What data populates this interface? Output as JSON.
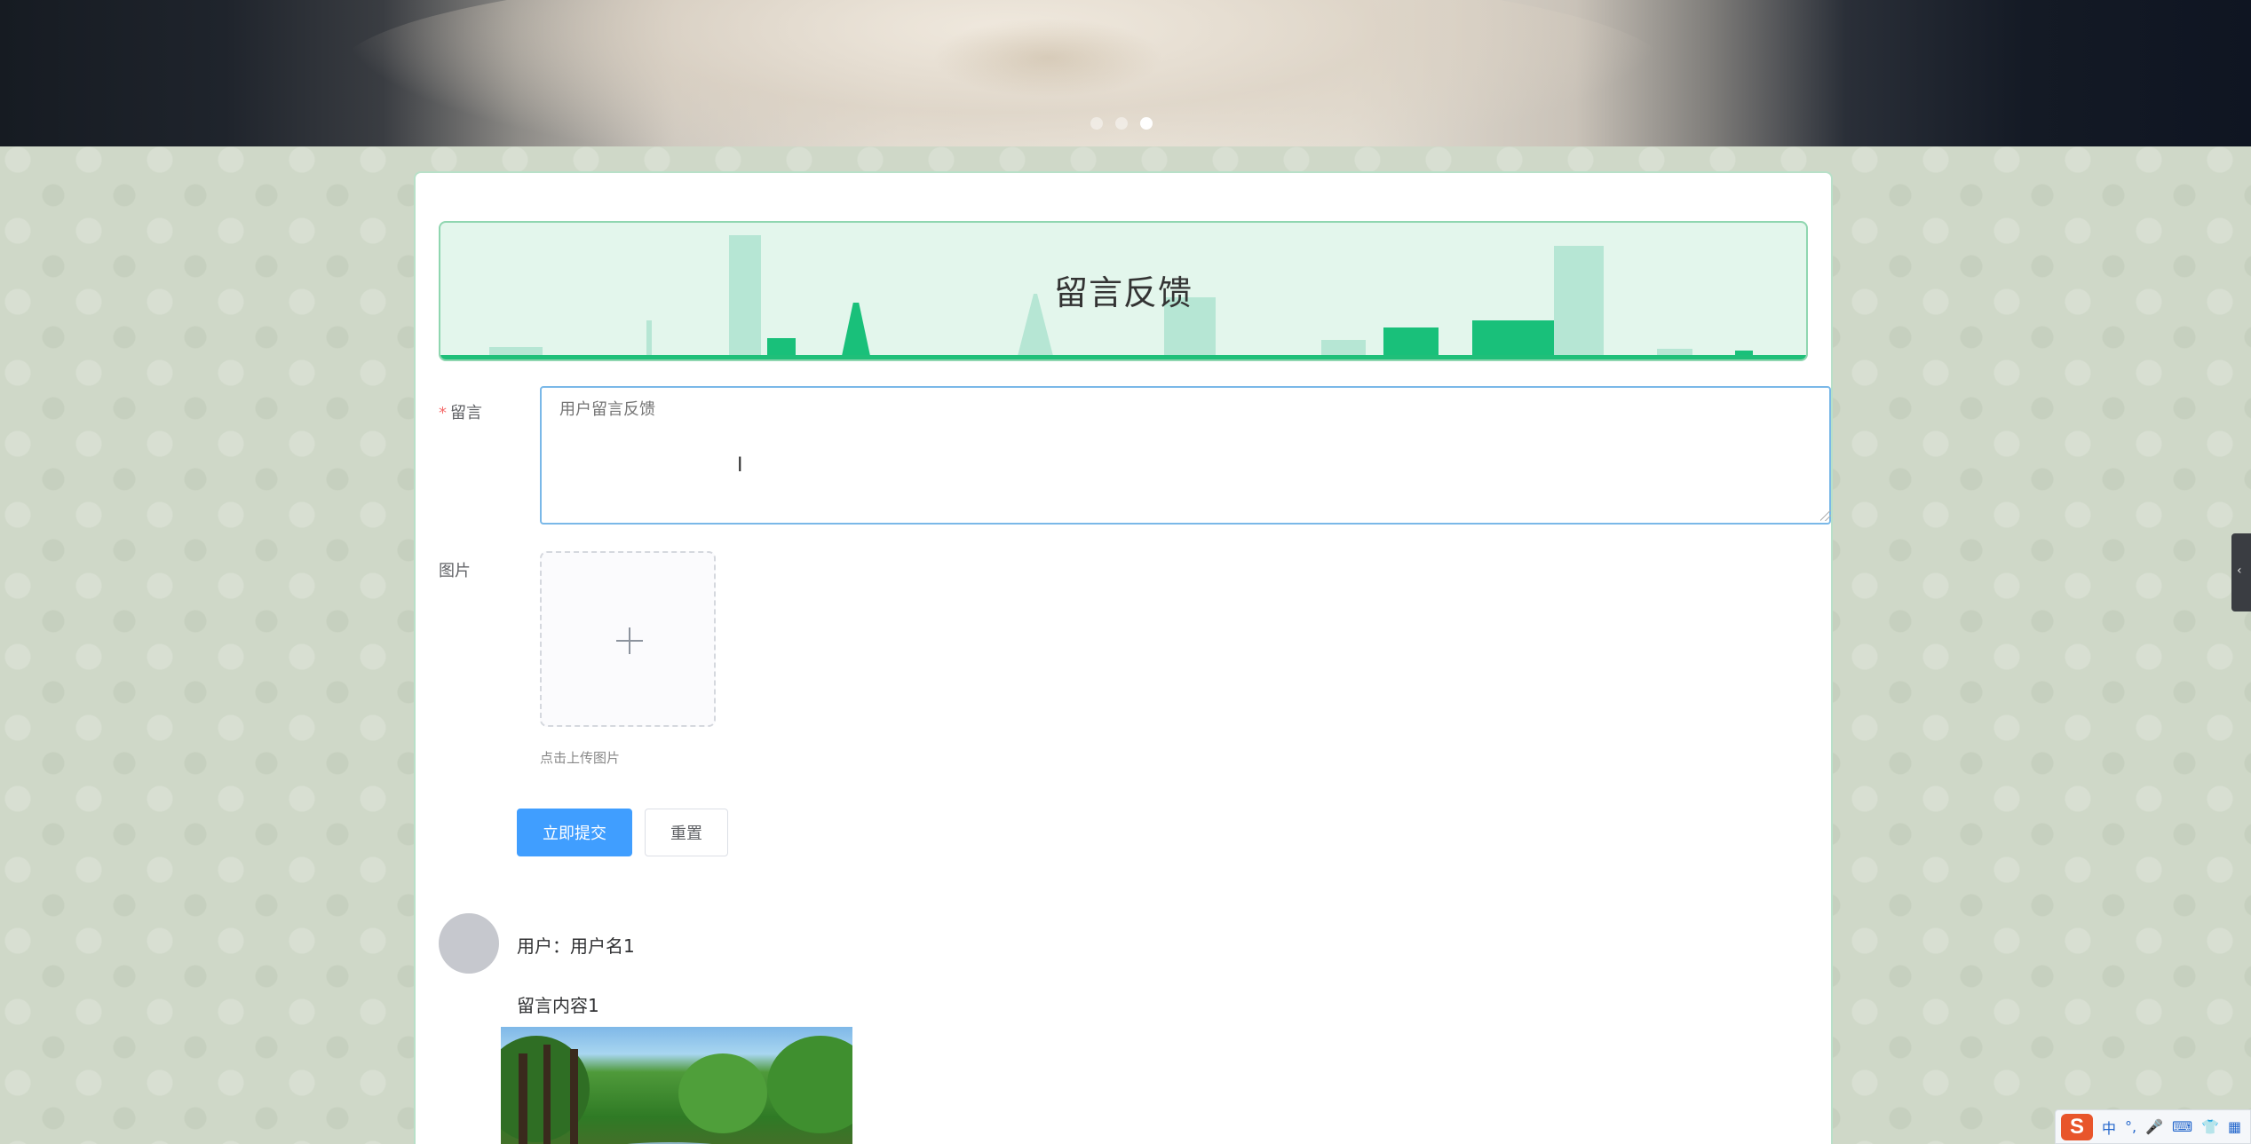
{
  "carousel": {
    "slides": 3,
    "active_index": 2
  },
  "page": {
    "title": "留言反馈"
  },
  "form": {
    "message": {
      "label": "留言",
      "required_mark": "*",
      "placeholder": "用户留言反馈",
      "value": ""
    },
    "image": {
      "label": "图片",
      "tip": "点击上传图片"
    },
    "submit_label": "立即提交",
    "reset_label": "重置"
  },
  "comments": [
    {
      "user_label": "用户：用户名1",
      "content": "留言内容1"
    }
  ],
  "ime": {
    "logo": "S",
    "lang": "中",
    "punct": "°,",
    "icons": [
      "mic-icon",
      "keyboard-icon",
      "shirt-icon",
      "grid-icon"
    ]
  },
  "colors": {
    "primary": "#409eff",
    "banner_bg": "#e3f6ec",
    "banner_accent": "#19c07a",
    "required": "#f56c6c"
  }
}
